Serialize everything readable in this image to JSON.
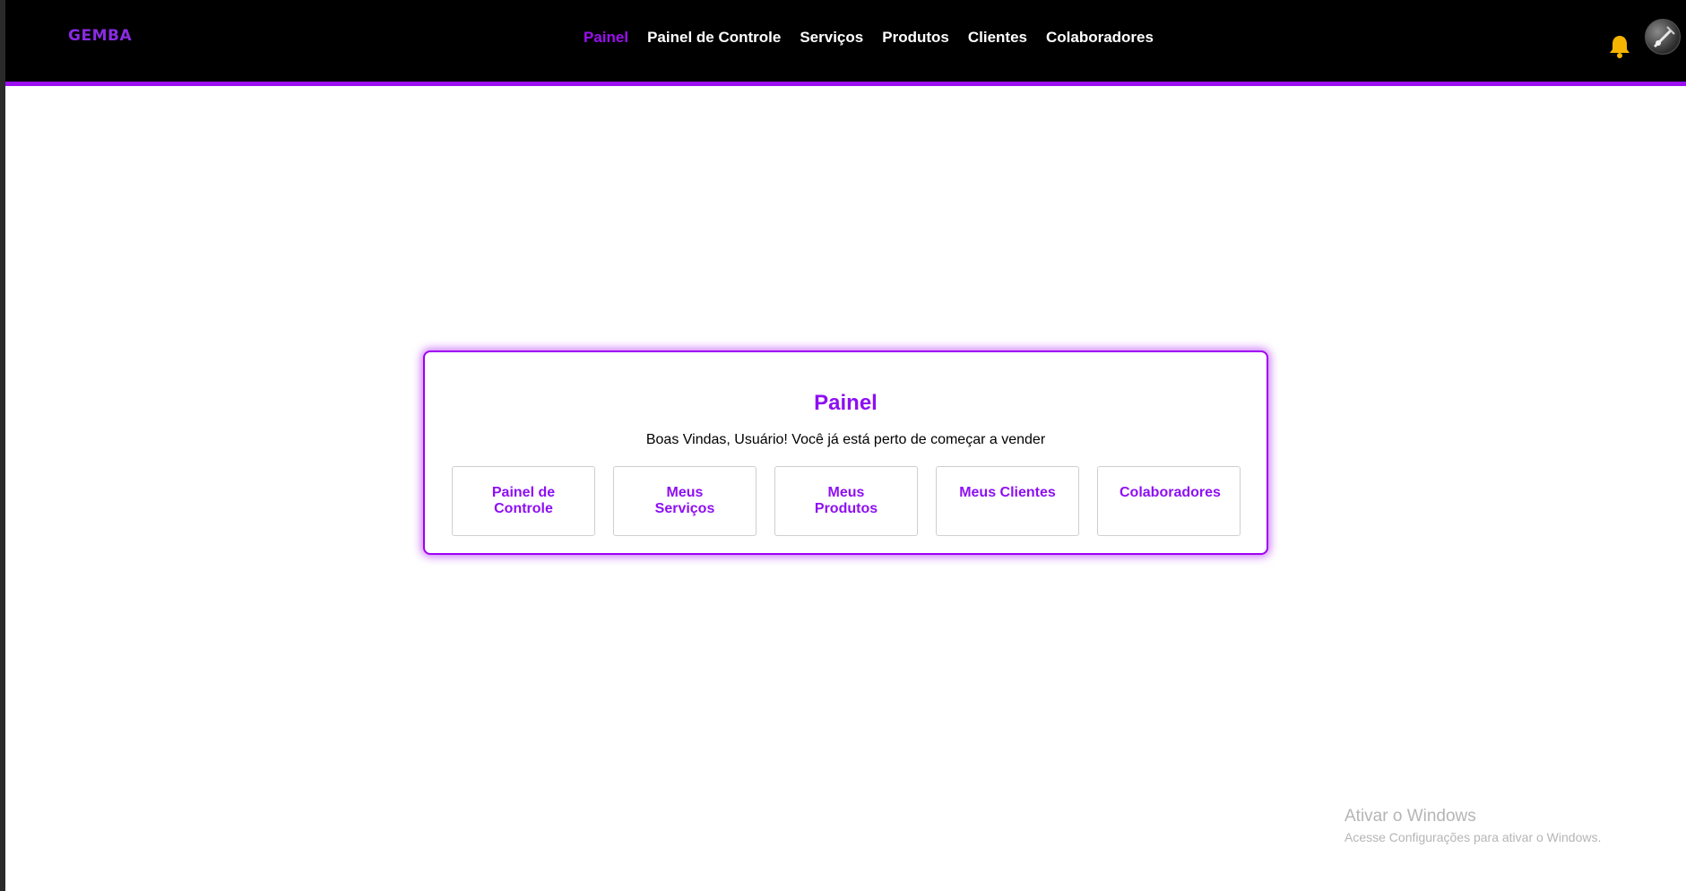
{
  "header": {
    "logo": "GEMBA",
    "nav": [
      {
        "label": "Painel",
        "active": true
      },
      {
        "label": "Painel de Controle",
        "active": false
      },
      {
        "label": "Serviços",
        "active": false
      },
      {
        "label": "Produtos",
        "active": false
      },
      {
        "label": "Clientes",
        "active": false
      },
      {
        "label": "Colaboradores",
        "active": false
      }
    ],
    "notification_icon": "bell-icon",
    "avatar_icon": "user-avatar"
  },
  "panel": {
    "title": "Painel",
    "subtitle": "Boas Vindas, Usuário! Você já está perto de começar a vender",
    "tiles": [
      {
        "label": "Painel de Controle"
      },
      {
        "label": "Meus Serviços"
      },
      {
        "label": "Meus Produtos"
      },
      {
        "label": "Meus Clientes"
      },
      {
        "label": "Colaboradores"
      }
    ]
  },
  "watermark": {
    "title": "Ativar o Windows",
    "subtitle": "Acesse Configurações para ativar o Windows."
  },
  "colors": {
    "accent": "#9b0ff0",
    "header_bg": "#000000",
    "bell": "#f5b400",
    "page_bg": "#ffffff"
  }
}
